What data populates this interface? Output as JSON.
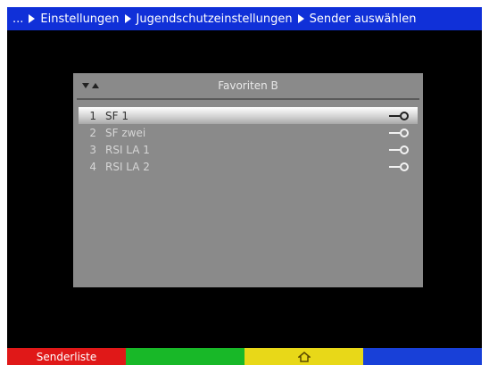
{
  "breadcrumb": {
    "prefix": "...",
    "items": [
      "Einstellungen",
      "Jugendschutzeinstellungen",
      "Sender auswählen"
    ]
  },
  "panel": {
    "title": "Favoriten B"
  },
  "channels": [
    {
      "number": "1",
      "name": "SF 1",
      "selected": true
    },
    {
      "number": "2",
      "name": "SF zwei",
      "selected": false
    },
    {
      "number": "3",
      "name": "RSI LA 1",
      "selected": false
    },
    {
      "number": "4",
      "name": "RSI LA 2",
      "selected": false
    }
  ],
  "color_keys": {
    "red_label": "Senderliste",
    "green_label": "",
    "yellow_icon": "home-icon",
    "blue_label": ""
  },
  "colors": {
    "header_blue": "#1030d8",
    "panel_gray": "#8a8a8a",
    "red": "#e01818",
    "green": "#18b828",
    "yellow": "#e8d818",
    "blue": "#1840d8"
  }
}
